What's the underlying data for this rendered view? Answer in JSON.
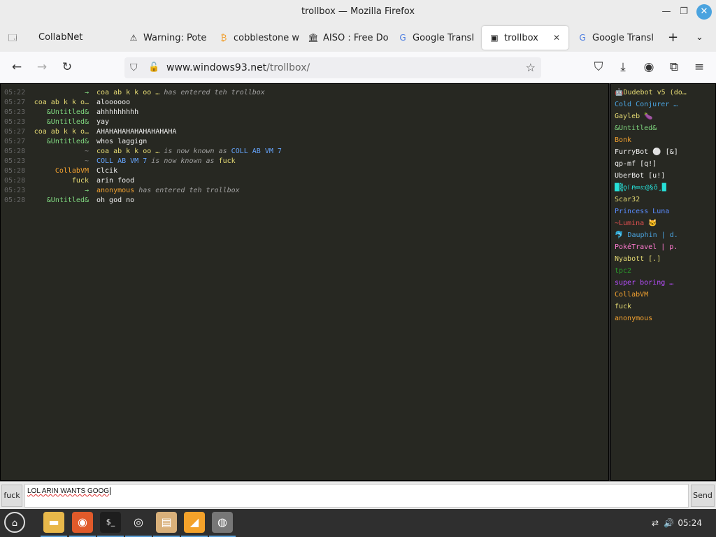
{
  "window": {
    "title": "trollbox — Mozilla Firefox"
  },
  "tabs": [
    {
      "label": "CollabNet",
      "icon": "list-all-tabs-icon"
    },
    {
      "label": "Warning: Pote",
      "icon": "warning-icon"
    },
    {
      "label": "cobblestone w",
      "icon": "bitcoin-icon"
    },
    {
      "label": "AISO : Free Do",
      "icon": "archive-icon"
    },
    {
      "label": "Google Transl",
      "icon": "translate-icon"
    },
    {
      "label": "trollbox",
      "icon": "trollbox-icon",
      "active": true
    },
    {
      "label": "Google Transl",
      "icon": "translate-icon"
    }
  ],
  "nav": {
    "url_host": "www.windows93.net",
    "url_path": "/trollbox/"
  },
  "messages": [
    {
      "time": "05:22",
      "nick": "→",
      "nick_color": "#7fd77f",
      "sys_name": "coa ab k k oo …",
      "sys_name_color": "#e6db74",
      "text": " has entered teh trollbox",
      "sys": true
    },
    {
      "time": "05:27",
      "nick": "coa ab k k o…",
      "nick_color": "#e6db74",
      "text": "aloooooo"
    },
    {
      "time": "05:23",
      "nick": "&Untitled&",
      "nick_color": "#7fd77f",
      "text": "ahhhhhhhhh"
    },
    {
      "time": "05:23",
      "nick": "&Untitled&",
      "nick_color": "#7fd77f",
      "text": "yay"
    },
    {
      "time": "05:27",
      "nick": "coa ab k k o…",
      "nick_color": "#e6db74",
      "text": "AHAHAHAHAHAHAHAHAHA"
    },
    {
      "time": "05:27",
      "nick": "&Untitled&",
      "nick_color": "#7fd77f",
      "text": "whos laggign"
    },
    {
      "time": "05:28",
      "nick": "~",
      "nick_color": "#888888",
      "sys_name": "coa ab k k oo …",
      "sys_name_color": "#e6db74",
      "text": " is now known as ",
      "sys_suffix": "COLL AB VM 7",
      "sys_suffix_color": "#66a6ff",
      "sys": true
    },
    {
      "time": "05:23",
      "nick": "~",
      "nick_color": "#888888",
      "sys_name": "COLL AB VM 7",
      "sys_name_color": "#66a6ff",
      "text": " is now known as ",
      "sys_suffix": "fuck",
      "sys_suffix_color": "#e6db74",
      "sys": true
    },
    {
      "time": "05:28",
      "nick": "CollabVM",
      "nick_color": "#f0a030",
      "text": "Clcik"
    },
    {
      "time": "05:28",
      "nick": "fuck",
      "nick_color": "#e6db74",
      "text": "arin food"
    },
    {
      "time": "05:23",
      "nick": "→",
      "nick_color": "#7fd77f",
      "sys_name": "anonymous",
      "sys_name_color": "#f0a030",
      "text": " has entered teh trollbox",
      "sys": true
    },
    {
      "time": "05:28",
      "nick": "&Untitled&",
      "nick_color": "#7fd77f",
      "text": "oh god no"
    }
  ],
  "users": [
    {
      "name": "🤖Dudebot v5 (do…",
      "color": "#e6db74"
    },
    {
      "name": "Cold Conjurer …",
      "color": "#4aa3df"
    },
    {
      "name": "Gayleb 🍆",
      "color": "#e6db74"
    },
    {
      "name": "&Untitled&",
      "color": "#7fd77f"
    },
    {
      "name": "Bonk",
      "color": "#f0a030"
    },
    {
      "name": "FurryBot ⚪ [&]",
      "color": "#f0f0f0"
    },
    {
      "name": "qp-mf [q!]",
      "color": "#f0f0f0"
    },
    {
      "name": "UberBot [u!]",
      "color": "#f0f0f0"
    },
    {
      "name": "█▒ǫ꜍ꞥ∞ಖ@§ō¸█",
      "color": "#27e0d8"
    },
    {
      "name": "Scar32",
      "color": "#e6db74"
    },
    {
      "name": "Princess Luna",
      "color": "#5a8cff"
    },
    {
      "name": "~Lumina 🐱",
      "color": "#e05050"
    },
    {
      "name": "🐬 Dauphin | d.",
      "color": "#4aa3df"
    },
    {
      "name": "PokéTravel | p.",
      "color": "#ff7ad0"
    },
    {
      "name": "Nyabott [.]",
      "color": "#e6db74"
    },
    {
      "name": "tpc2",
      "color": "#2a9a2a"
    },
    {
      "name": "super boring …",
      "color": "#b84dff"
    },
    {
      "name": "CollabVM",
      "color": "#f0a030"
    },
    {
      "name": "fuck",
      "color": "#e6db74"
    },
    {
      "name": "anonymous",
      "color": "#f0a030"
    }
  ],
  "input": {
    "nick_label": "fuck",
    "value": "LOL ARIN WANTS GOOG",
    "send_label": "Send"
  },
  "taskbar": {
    "clock": "05:24"
  }
}
